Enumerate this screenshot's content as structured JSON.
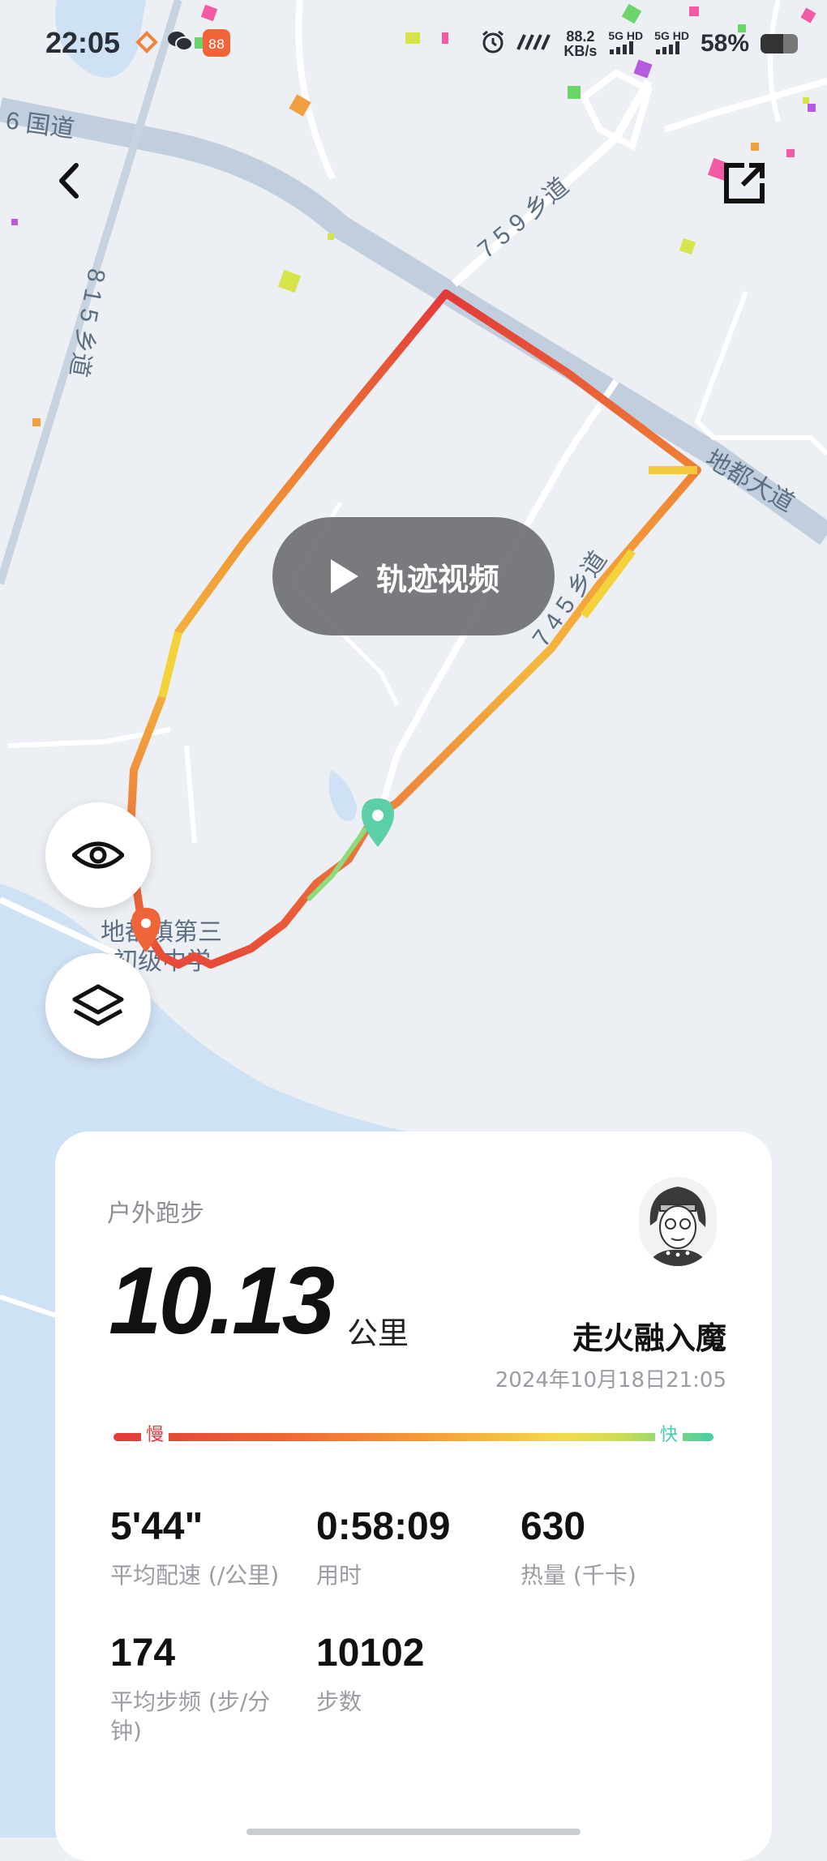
{
  "status_bar": {
    "time": "22:05",
    "network_speed_value": "88.2",
    "network_speed_unit": "KB/s",
    "signal1": "5G HD",
    "signal2": "5G HD",
    "battery": "58%"
  },
  "map": {
    "road_labels": {
      "national_road": "6 国道",
      "township_road_815": "8 1 5 乡道",
      "township_road_759": "7 5 9 乡道",
      "avenue": "地都大道",
      "road_partial": "7 4 5 乡道",
      "school": "地都镇第三",
      "school_line2": "初级中学"
    }
  },
  "controls": {
    "video_button_label": "轨迹视频"
  },
  "summary": {
    "sport_type": "户外跑步",
    "distance": "10.13",
    "distance_unit": "公里",
    "username": "走火融入魔",
    "datetime": "2024年10月18日21:05",
    "pace_slow_label": "慢",
    "pace_fast_label": "快",
    "stats": [
      {
        "value": "5'44\"",
        "label": "平均配速 (/公里)"
      },
      {
        "value": "0:58:09",
        "label": "用时"
      },
      {
        "value": "630",
        "label": "热量 (千卡)"
      },
      {
        "value": "174",
        "label": "平均步频 (步/分钟)"
      },
      {
        "value": "10102",
        "label": "步数"
      }
    ]
  },
  "colors": {
    "route_slow": "#e23a3a",
    "route_mid": "#f08a35",
    "route_fast": "#f2dc4a",
    "start_marker": "#5ccfa6",
    "end_marker": "#f0643a"
  }
}
